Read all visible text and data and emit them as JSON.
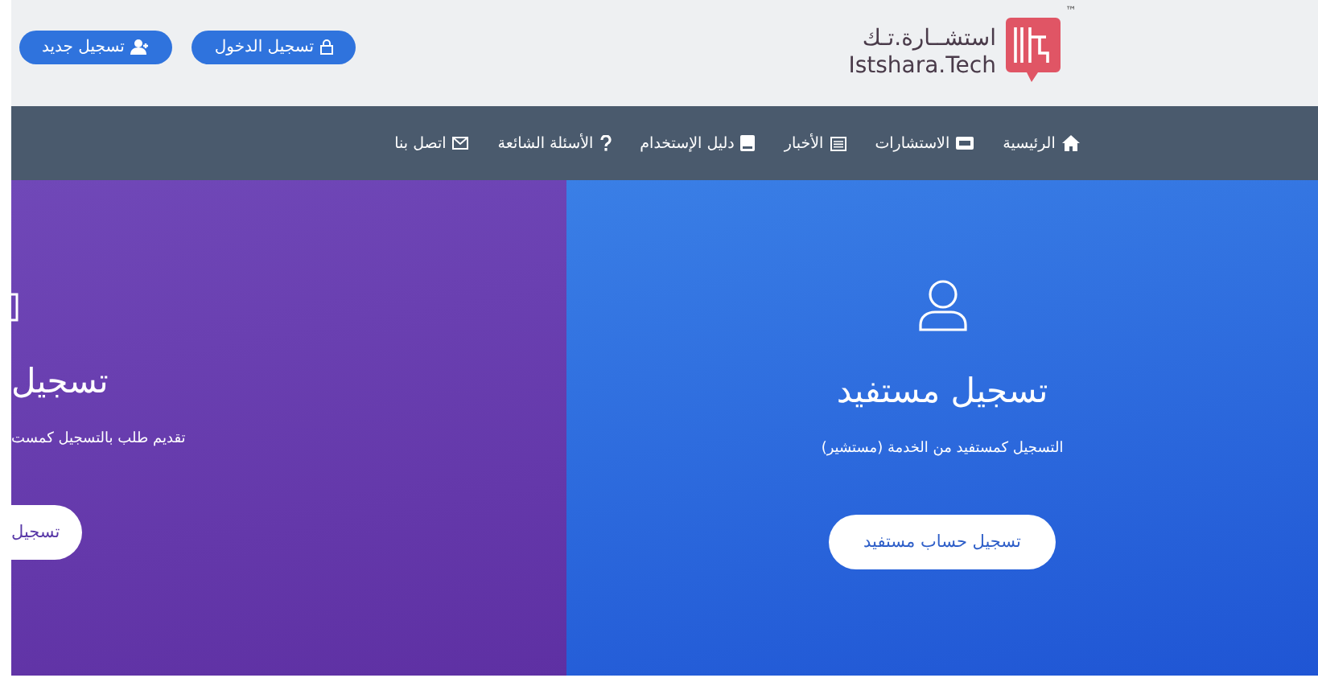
{
  "header": {
    "logo": {
      "arabic": "استشــارة.تـك",
      "latin": "Istshara.Tech",
      "trademark": "™"
    },
    "buttons": [
      {
        "label": "تسجيل الدخول",
        "kind": "login"
      },
      {
        "label": "تسجيل جديد",
        "kind": "signup"
      }
    ]
  },
  "nav": [
    {
      "label": "الرئيسية",
      "kind": "home"
    },
    {
      "label": "الاستشارات",
      "kind": "consultations"
    },
    {
      "label": "الأخبار",
      "kind": "news"
    },
    {
      "label": "دليل الإستخدام",
      "kind": "guide"
    },
    {
      "label": "الأسئلة الشائعة",
      "kind": "faq"
    },
    {
      "label": "اتصل بنا",
      "kind": "contact"
    }
  ],
  "panels": [
    {
      "kind": "full",
      "title": "تسجيل مستفيد",
      "subtitle": "التسجيل كمستفيد من الخدمة (مستشير)",
      "button": "تسجيل حساب مستفيد"
    },
    {
      "kind": "partial",
      "title": "تسجيل",
      "subtitle": "تقديم طلب بالتسجيل كمست",
      "button": "تسجيل"
    }
  ]
}
